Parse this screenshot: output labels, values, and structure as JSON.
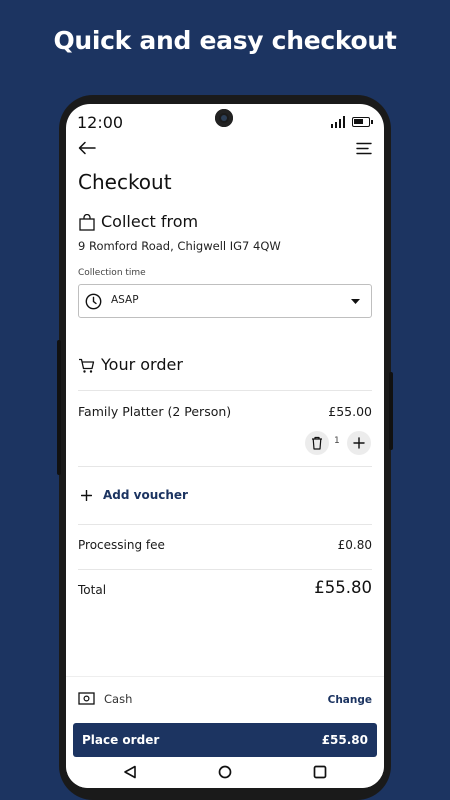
{
  "headline": "Quick and easy checkout",
  "status_bar": {
    "time": "12:00"
  },
  "header": {
    "title": "Checkout"
  },
  "collect": {
    "title": "Collect from",
    "address": "9 Romford Road, Chigwell IG7 4QW",
    "collection_time_label": "Collection time",
    "collection_time_value": "ASAP"
  },
  "order": {
    "title": "Your order",
    "items": [
      {
        "name": "Family Platter (2 Person)",
        "price": "£55.00",
        "quantity": "1"
      }
    ],
    "add_voucher_label": "Add voucher",
    "processing_fee_label": "Processing fee",
    "processing_fee_value": "£0.80",
    "total_label": "Total",
    "total_value": "£55.80"
  },
  "payment": {
    "method": "Cash",
    "change_label": "Change"
  },
  "place_order": {
    "label": "Place order",
    "amount": "£55.80"
  },
  "colors": {
    "brand_navy": "#1c3461",
    "background": "#ffffff"
  }
}
